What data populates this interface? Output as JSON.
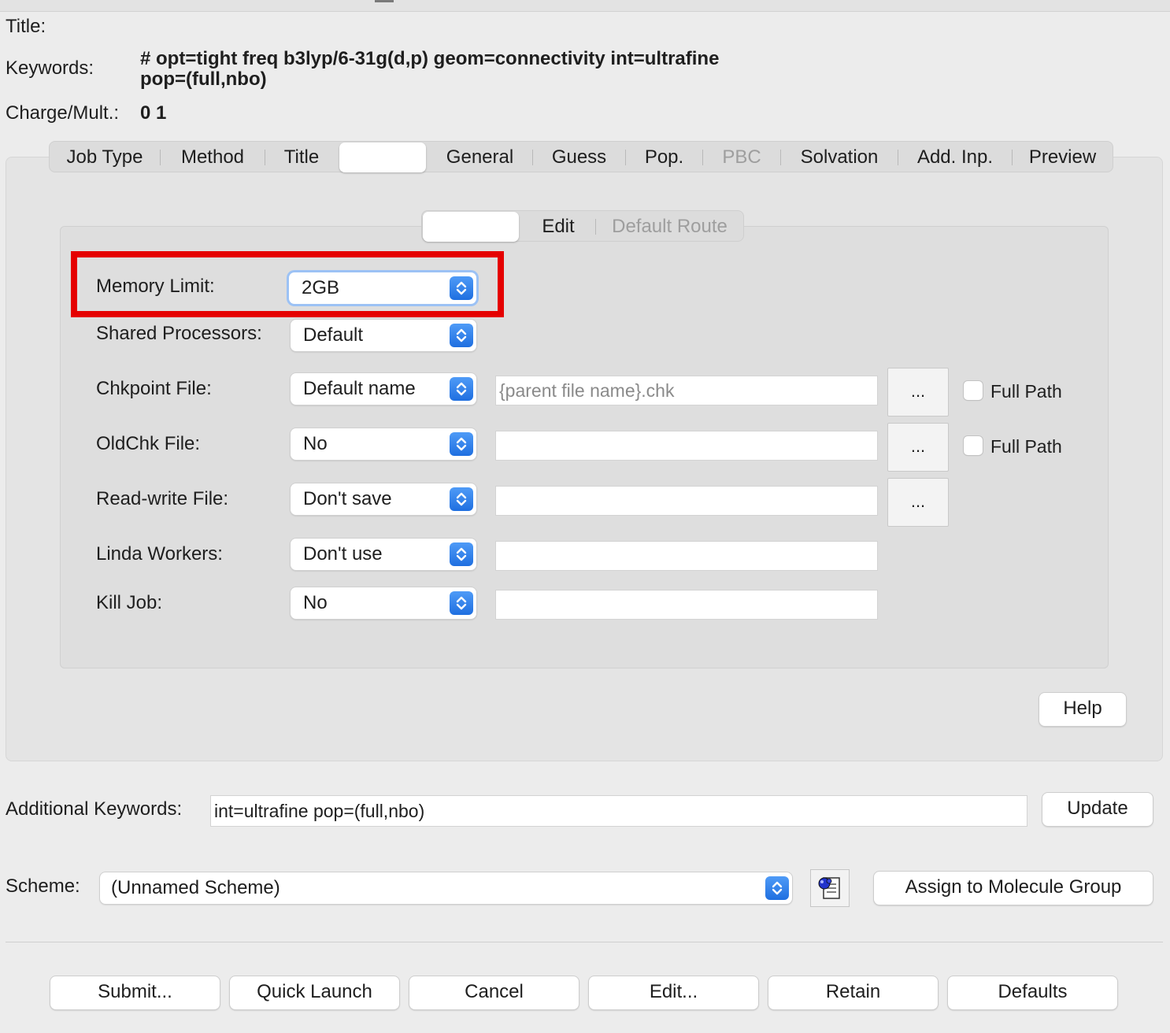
{
  "header": {
    "title_label": "Title:",
    "title_value": "",
    "keywords_label": "Keywords:",
    "keywords_line1": "# opt=tight freq b3lyp/6-31g(d,p) geom=connectivity int=ultrafine",
    "keywords_line2": "pop=(full,nbo)",
    "charge_label": "Charge/Mult.:",
    "charge_value": "0 1"
  },
  "tabs": [
    {
      "label": "Job Type",
      "selected": false,
      "disabled": false
    },
    {
      "label": "Method",
      "selected": false,
      "disabled": false
    },
    {
      "label": "Title",
      "selected": false,
      "disabled": false
    },
    {
      "label": "",
      "selected": true,
      "disabled": false
    },
    {
      "label": "General",
      "selected": false,
      "disabled": false
    },
    {
      "label": "Guess",
      "selected": false,
      "disabled": false
    },
    {
      "label": "Pop.",
      "selected": false,
      "disabled": false
    },
    {
      "label": "PBC",
      "selected": false,
      "disabled": true
    },
    {
      "label": "Solvation",
      "selected": false,
      "disabled": false
    },
    {
      "label": "Add. Inp.",
      "selected": false,
      "disabled": false
    },
    {
      "label": "Preview",
      "selected": false,
      "disabled": false
    }
  ],
  "subtabs": [
    {
      "label": "",
      "selected": true,
      "disabled": false
    },
    {
      "label": "Edit",
      "selected": false,
      "disabled": false
    },
    {
      "label": "Default Route",
      "selected": false,
      "disabled": true
    }
  ],
  "rows": {
    "memory": {
      "label": "Memory Limit:",
      "value": "2GB"
    },
    "shared": {
      "label": "Shared Processors:",
      "value": "Default"
    },
    "chk": {
      "label": "Chkpoint File:",
      "value": "Default name",
      "field_placeholder": "{parent file name}.chk",
      "browse": "...",
      "fullpath": "Full Path"
    },
    "oldchk": {
      "label": "OldChk File:",
      "value": "No",
      "field": "",
      "browse": "...",
      "fullpath": "Full Path"
    },
    "rwf": {
      "label": "Read-write File:",
      "value": "Don't save",
      "field": "",
      "browse": "..."
    },
    "linda": {
      "label": "Linda Workers:",
      "value": "Don't use",
      "field": ""
    },
    "kill": {
      "label": "Kill Job:",
      "value": "No",
      "field": ""
    }
  },
  "help_label": "Help",
  "additional": {
    "label": "Additional Keywords:",
    "value": "int=ultrafine pop=(full,nbo)",
    "update_label": "Update"
  },
  "scheme": {
    "label": "Scheme:",
    "value": "(Unnamed Scheme)",
    "assign_label": "Assign to Molecule Group"
  },
  "buttons": {
    "submit": "Submit...",
    "quick": "Quick Launch",
    "cancel": "Cancel",
    "edit": "Edit...",
    "retain": "Retain",
    "defaults": "Defaults"
  },
  "colors": {
    "highlight": "#e50000",
    "accent": "#1f6fe0"
  }
}
